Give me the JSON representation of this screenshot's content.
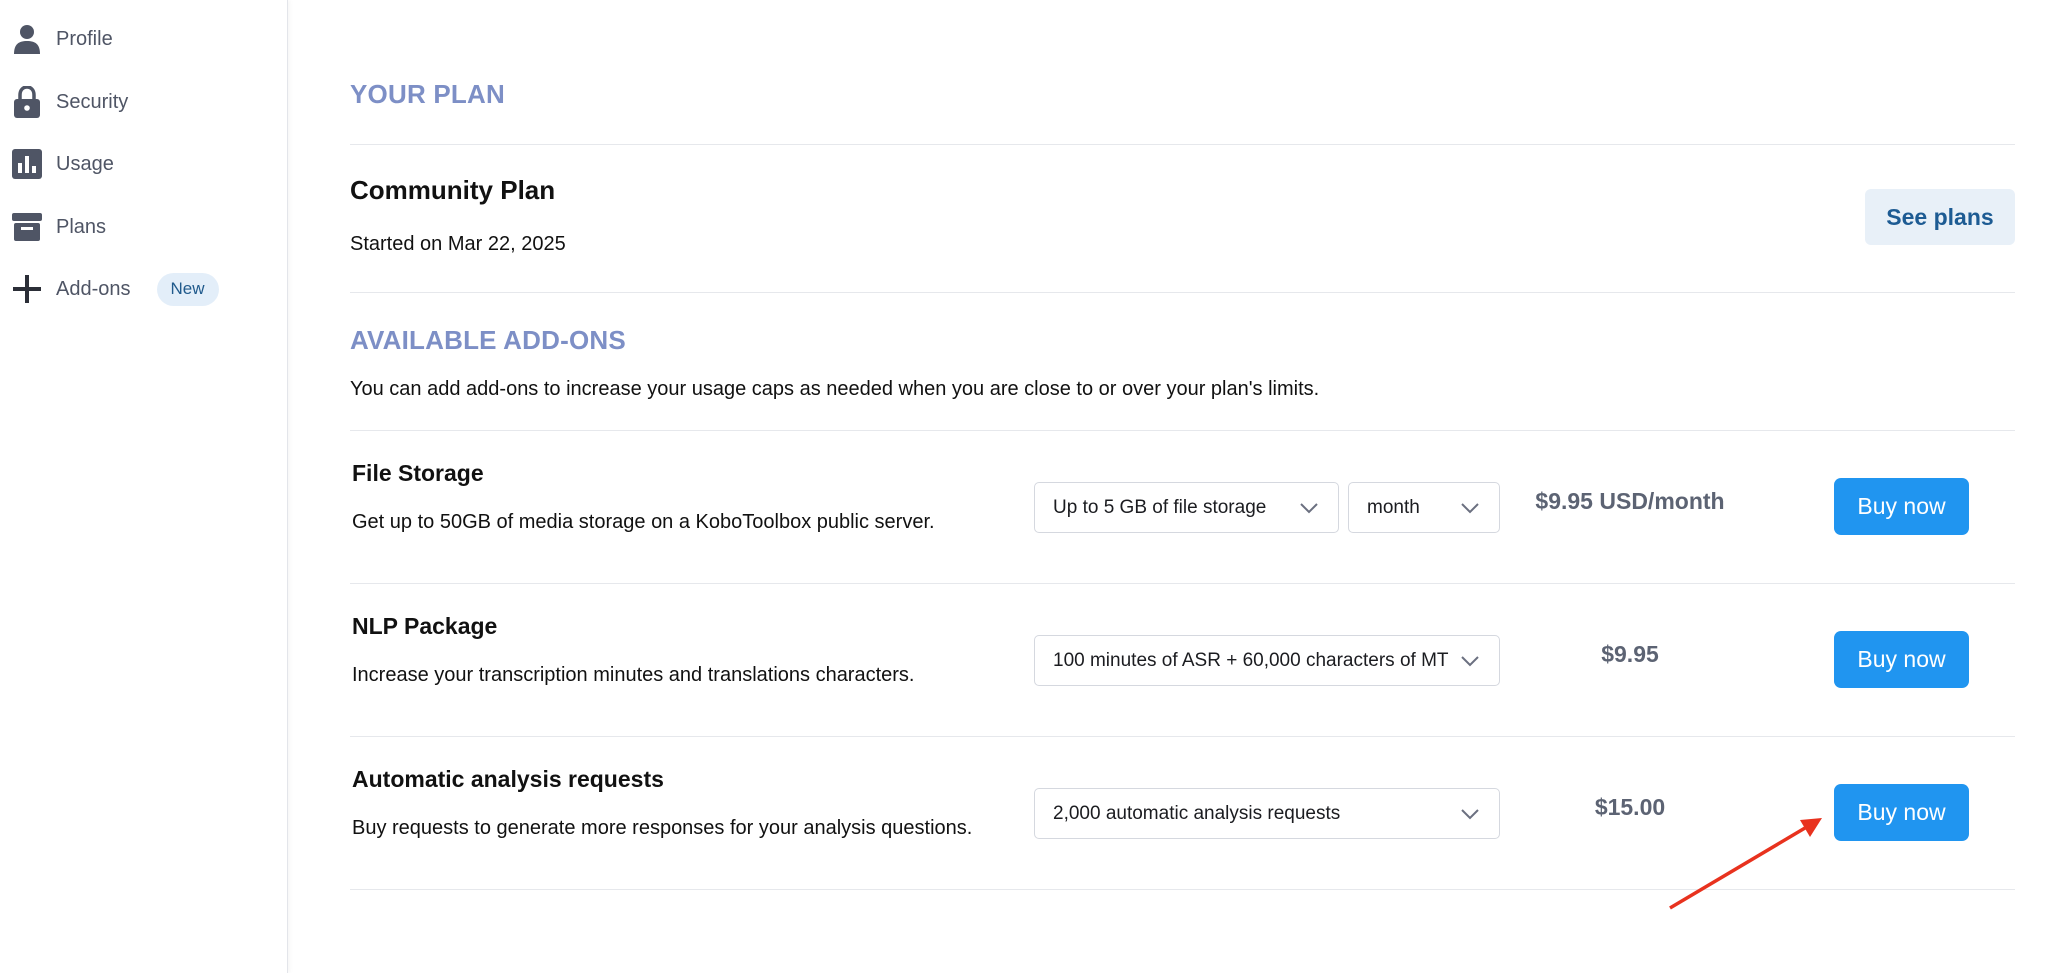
{
  "sidebar": {
    "items": [
      {
        "label": "Profile",
        "icon": "person-icon"
      },
      {
        "label": "Security",
        "icon": "lock-icon"
      },
      {
        "label": "Usage",
        "icon": "bar-chart-icon"
      },
      {
        "label": "Plans",
        "icon": "plans-icon"
      },
      {
        "label": "Add-ons",
        "icon": "plus-icon",
        "badge": "New"
      }
    ]
  },
  "plan": {
    "section_title": "YOUR PLAN",
    "name": "Community Plan",
    "started": "Started on Mar 22, 2025",
    "see_plans_label": "See plans"
  },
  "addons": {
    "section_title": "AVAILABLE ADD-ONS",
    "description": "You can add add-ons to increase your usage caps as needed when you are close to or over your plan's limits.",
    "rows": [
      {
        "name": "File Storage",
        "description": "Get up to 50GB of media storage on a KoboToolbox public server.",
        "select1": "Up to 5 GB of file storage",
        "select2": "month",
        "price": "$9.95 USD/month",
        "button": "Buy now"
      },
      {
        "name": "NLP Package",
        "description": "Increase your transcription minutes and translations characters.",
        "select1": "100 minutes of ASR + 60,000 characters of MT",
        "price": "$9.95",
        "button": "Buy now"
      },
      {
        "name": "Automatic analysis requests",
        "description": "Buy requests to generate more responses for your analysis questions.",
        "select1": "2,000 automatic analysis requests",
        "price": "$15.00",
        "button": "Buy now"
      }
    ]
  },
  "colors": {
    "accent": "#2095f0",
    "section_title": "#7d8fc6",
    "annotation_arrow": "#e8321e"
  }
}
